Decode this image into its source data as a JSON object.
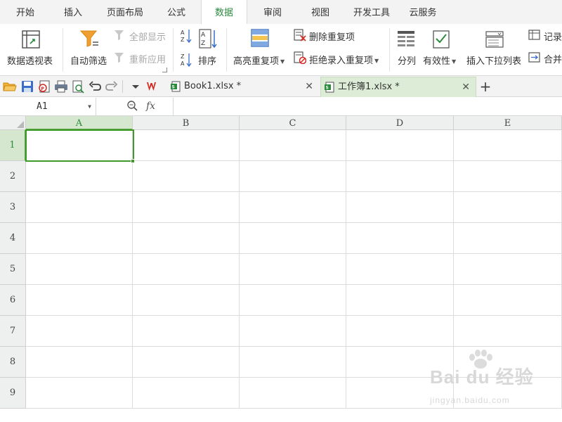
{
  "ribbon_tabs": [
    {
      "label": "开始"
    },
    {
      "label": "插入"
    },
    {
      "label": "页面布局"
    },
    {
      "label": "公式"
    },
    {
      "label": "数据",
      "active": true
    },
    {
      "label": "审阅"
    },
    {
      "label": "视图"
    },
    {
      "label": "开发工具"
    },
    {
      "label": "云服务"
    }
  ],
  "ribbon": {
    "pivot_table": "数据透视表",
    "auto_filter": "自动筛选",
    "show_all": "全部显示",
    "reapply": "重新应用",
    "sort": "排序",
    "highlight_duplicates": "高亮重复项",
    "remove_duplicates": "删除重复项",
    "reject_duplicates": "拒绝录入重复项",
    "text_to_columns": "分列",
    "validation": "有效性",
    "insert_dropdown": "插入下拉列表",
    "record": "记录",
    "merge": "合并"
  },
  "doc_tabs": [
    {
      "label": "Book1.xlsx *",
      "active": false
    },
    {
      "label": "工作簿1.xlsx *",
      "active": true
    }
  ],
  "formula_bar": {
    "name_box": "A1",
    "fx_label": "fx",
    "formula": ""
  },
  "grid": {
    "columns": [
      "A",
      "B",
      "C",
      "D",
      "E"
    ],
    "rows": [
      "1",
      "2",
      "3",
      "4",
      "5",
      "6",
      "7",
      "8",
      "9"
    ],
    "active_cell": "A1"
  },
  "watermark": {
    "main": "Bai du 经验",
    "sub": "jingyan.baidu.com"
  },
  "colors": {
    "accent_green": "#3e9a2a",
    "active_tab_text": "#2c8a3d",
    "header_selected_bg": "#d5e8cf",
    "wps_red": "#d6261e"
  }
}
